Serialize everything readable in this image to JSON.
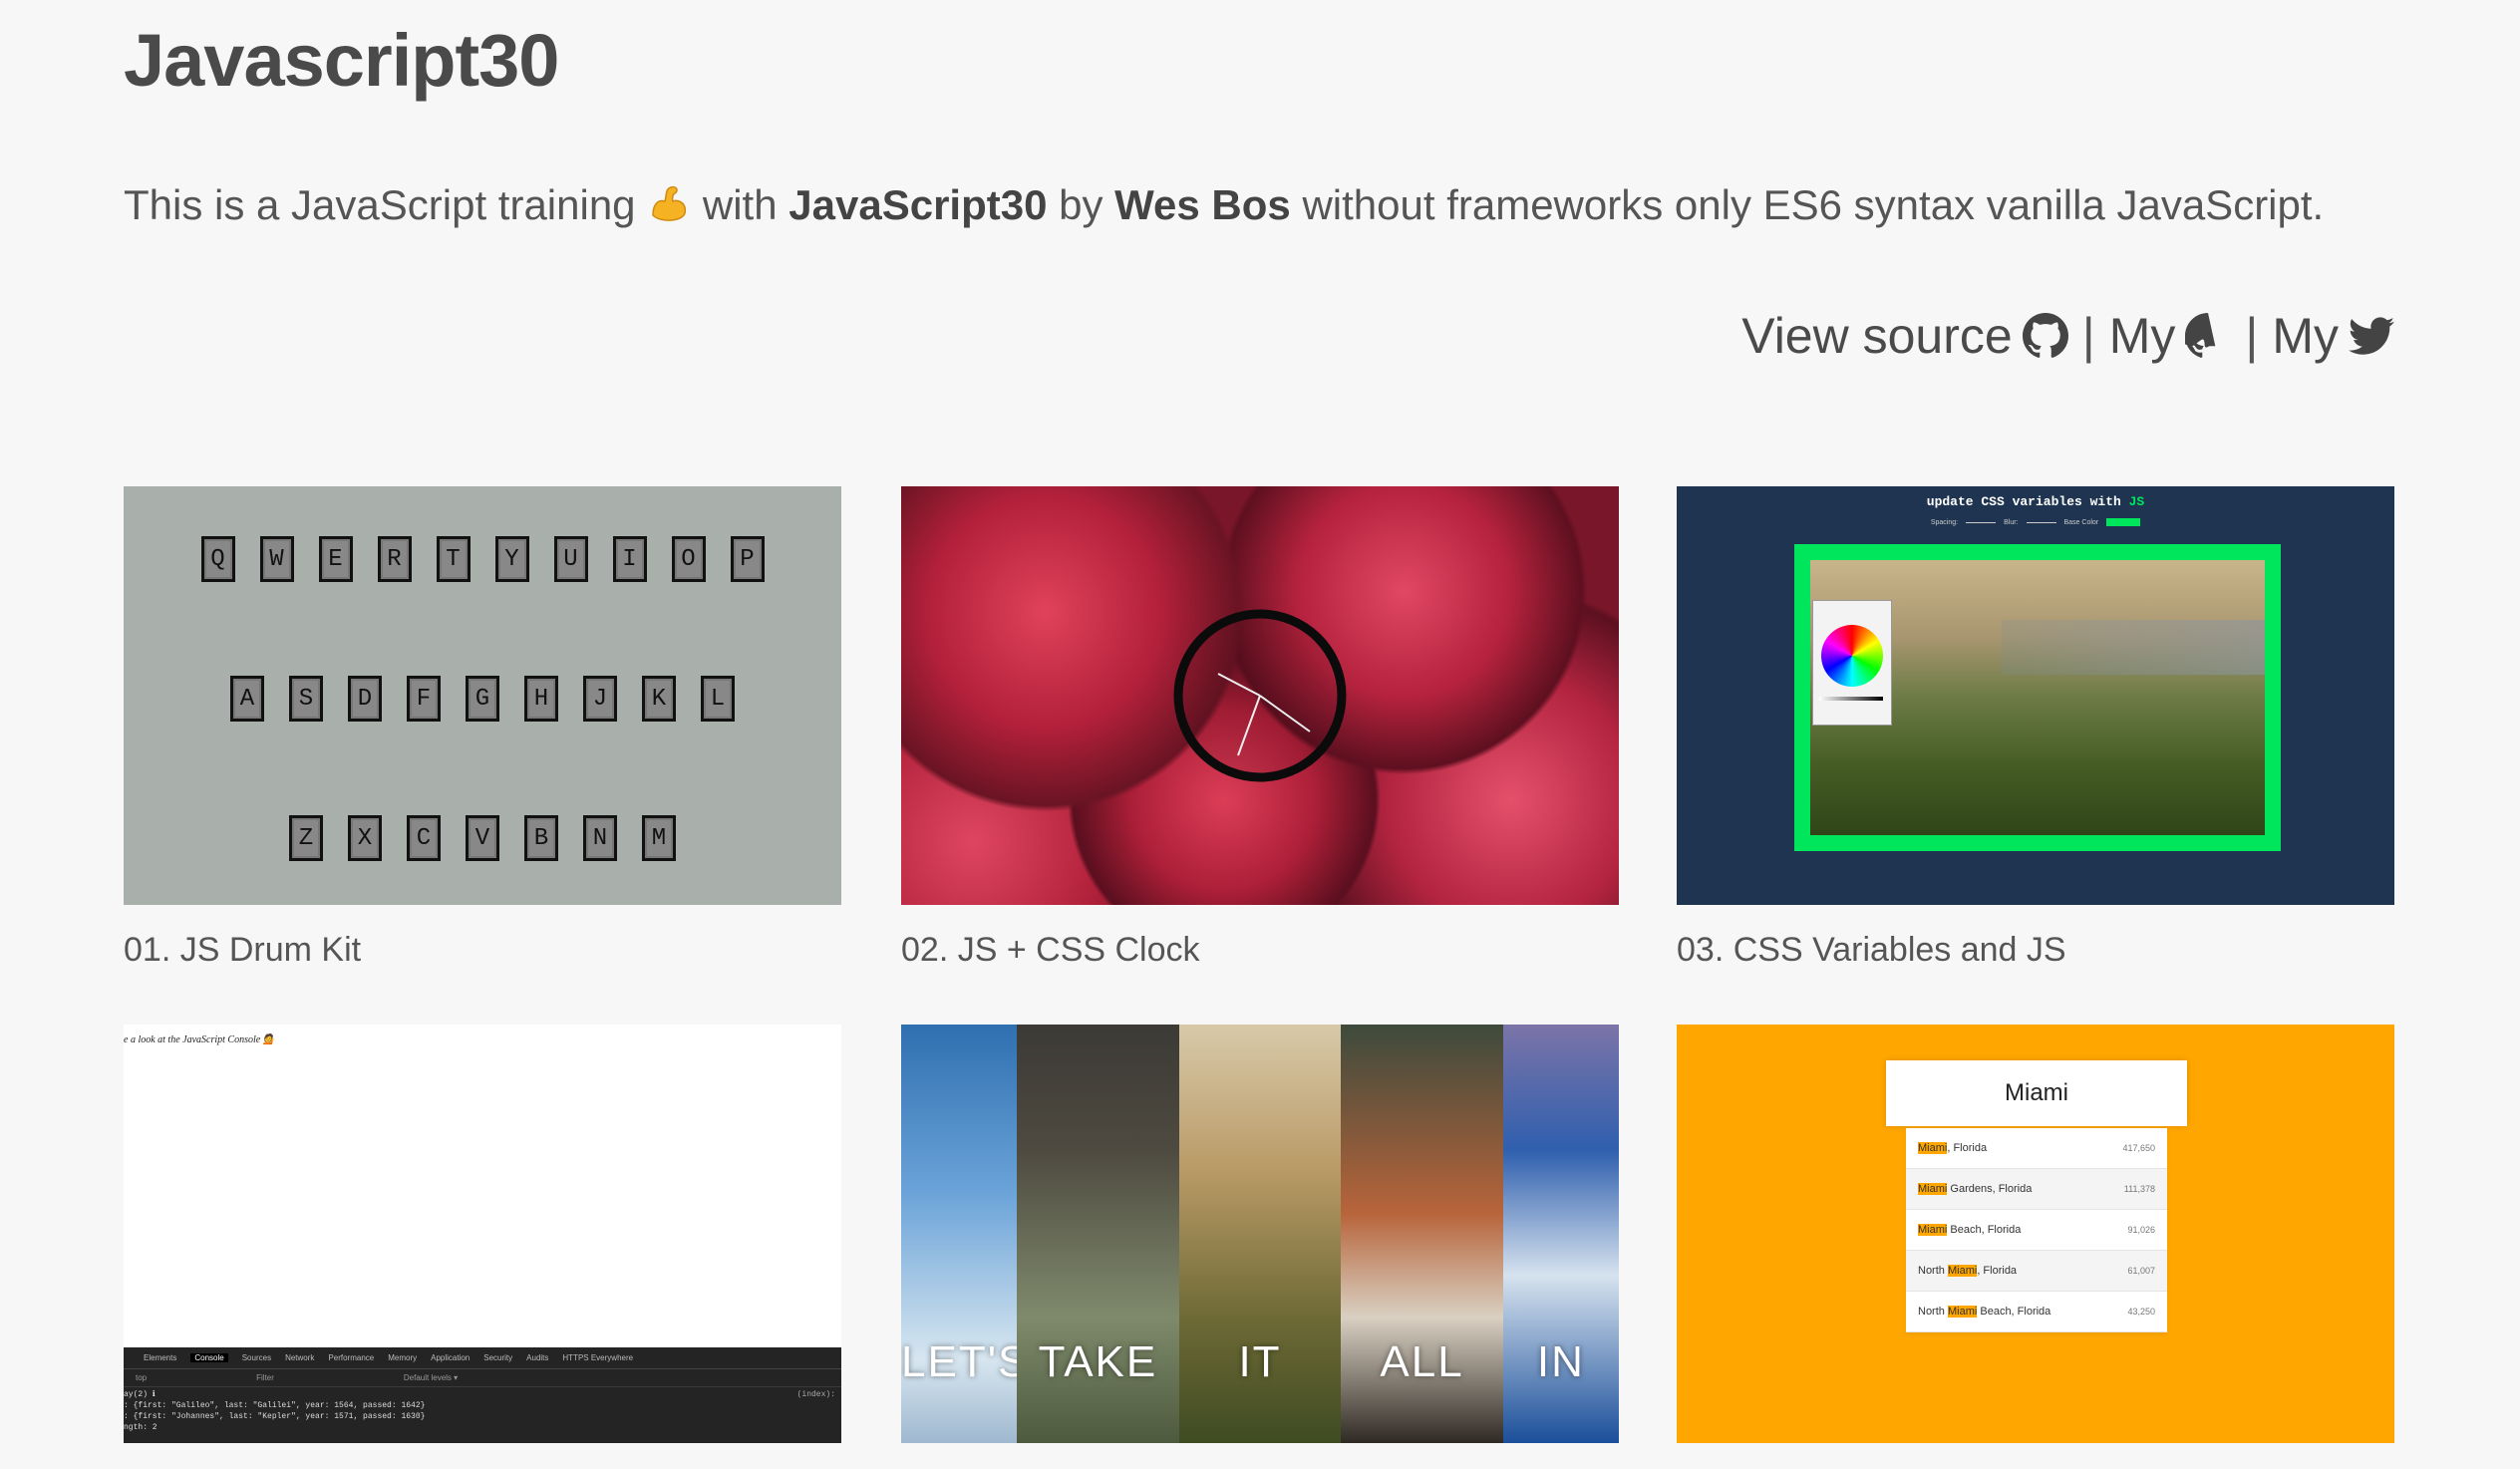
{
  "header": {
    "title": "Javascript30",
    "intro_before": "This is a JavaScript training",
    "intro_with": "with",
    "intro_course": "JavaScript30",
    "intro_by": "by",
    "intro_author": "Wes Bos",
    "intro_after": "without frameworks only ES6 syntax vanilla JavaScript."
  },
  "links": {
    "view_source": "View source",
    "separator": "|",
    "my_github": "My",
    "my_twitter": "My"
  },
  "cards": [
    {
      "caption": "01. JS Drum Kit"
    },
    {
      "caption": "02. JS + CSS Clock"
    },
    {
      "caption": "03. CSS Variables and JS"
    },
    {
      "caption": ""
    },
    {
      "caption": ""
    },
    {
      "caption": ""
    }
  ],
  "drum_keys": {
    "row1": [
      "Q",
      "W",
      "E",
      "R",
      "T",
      "Y",
      "U",
      "I",
      "O",
      "P"
    ],
    "row2": [
      "A",
      "S",
      "D",
      "F",
      "G",
      "H",
      "J",
      "K",
      "L"
    ],
    "row3": [
      "Z",
      "X",
      "C",
      "V",
      "B",
      "N",
      "M"
    ]
  },
  "css_vars_thumb": {
    "heading": "update CSS variables with",
    "heading_js": "JS",
    "spacing": "Spacing:",
    "blur": "Blur:",
    "base_color": "Base Color"
  },
  "console_thumb": {
    "page_text": "e a look at the JavaScript Console 💁",
    "tabs": [
      "Elements",
      "Console",
      "Sources",
      "Network",
      "Performance",
      "Memory",
      "Application",
      "Security",
      "Audits",
      "HTTPS Everywhere"
    ],
    "context": "top",
    "filter": "Filter",
    "levels": "Default levels ▾",
    "source": "(index):",
    "lines": [
      "ay(2) ℹ",
      ": {first: \"Galileo\", last: \"Galilei\", year: 1564, passed: 1642}",
      ": {first: \"Johannes\", last: \"Kepler\", year: 1571, passed: 1630}",
      "ngth: 2"
    ]
  },
  "panels_thumb": {
    "words": [
      "LET'S",
      "TAKE",
      "IT",
      "ALL",
      "IN"
    ]
  },
  "typeahead_thumb": {
    "search_value": "Miami",
    "results": [
      {
        "pre": "",
        "hl": "Miami",
        "post": ", Florida",
        "pop": "417,650"
      },
      {
        "pre": "",
        "hl": "Miami",
        "post": " Gardens, Florida",
        "pop": "111,378"
      },
      {
        "pre": "",
        "hl": "Miami",
        "post": " Beach, Florida",
        "pop": "91,026"
      },
      {
        "pre": "North ",
        "hl": "Miami",
        "post": ", Florida",
        "pop": "61,007"
      },
      {
        "pre": "North ",
        "hl": "Miami",
        "post": " Beach, Florida",
        "pop": "43,250"
      }
    ]
  },
  "colors": {
    "background": "#f7f7f7",
    "text": "#4a4a4a",
    "drum_bg": "#a9b0ab",
    "vars_bg": "#1e3450",
    "vars_green": "#00e65c",
    "typeahead_bg": "#ffa600"
  }
}
